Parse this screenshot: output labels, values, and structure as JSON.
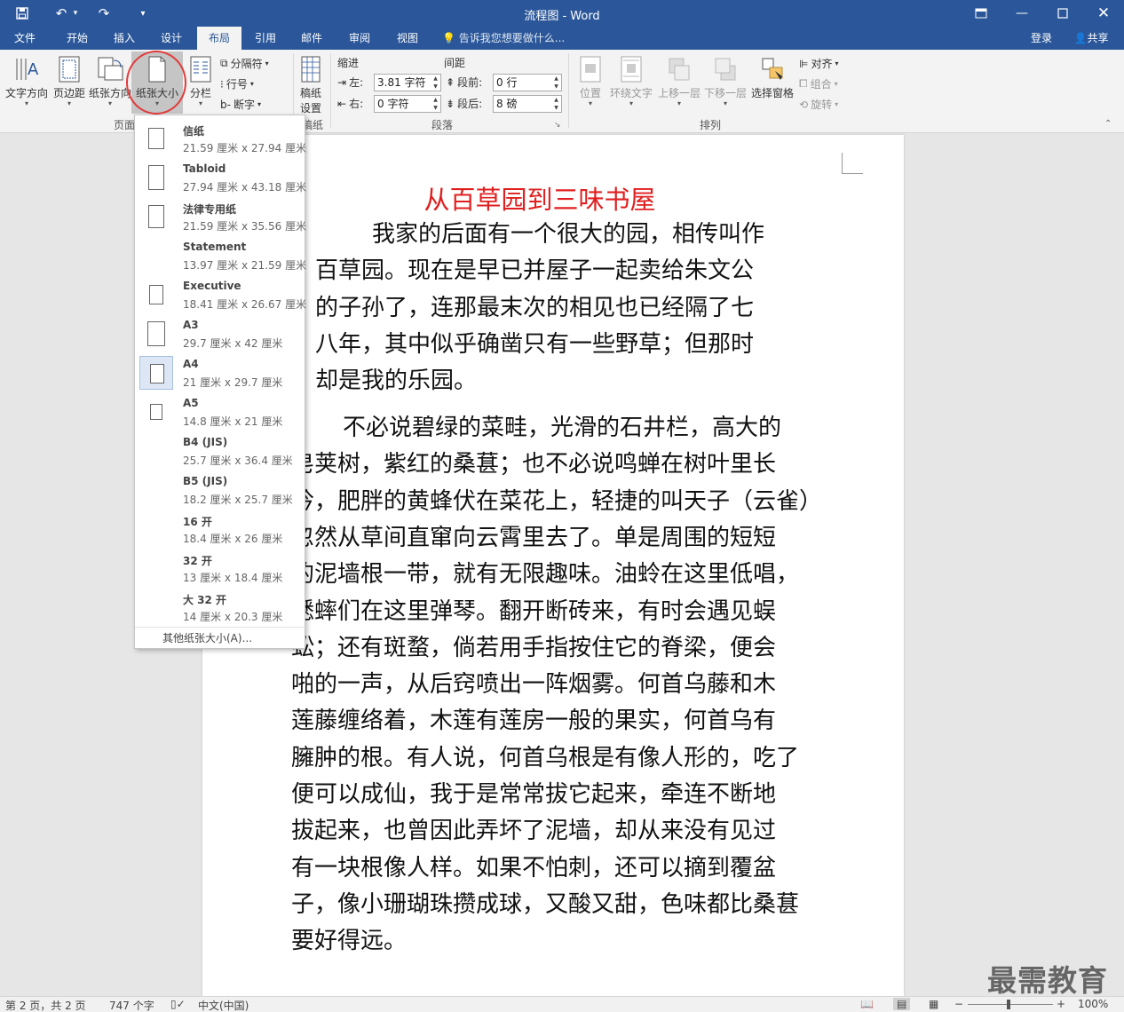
{
  "app": {
    "window_title": "流程图 - Word",
    "watermark": "最需教育"
  },
  "quick_access": [
    "save-icon",
    "undo-icon",
    "redo-icon",
    "customize-icon"
  ],
  "tabs": {
    "file": "文件",
    "home": "开始",
    "insert": "插入",
    "design": "设计",
    "layout": "布局",
    "references": "引用",
    "mailings": "邮件",
    "review": "审阅",
    "view": "视图"
  },
  "tell_me": "告诉我您想要做什么...",
  "account": {
    "login": "登录",
    "share": "共享"
  },
  "ribbon": {
    "page_setup": {
      "text_direction": "文字方向",
      "margins": "页边距",
      "orientation": "纸张方向",
      "size": "纸张大小",
      "columns": "分栏",
      "breaks": "分隔符",
      "line_numbers": "行号",
      "hyphenation": "断字",
      "group_label": "页面"
    },
    "manuscript": {
      "label": "稿纸",
      "label2": "设置",
      "group_label": "稿纸"
    },
    "paragraph": {
      "indent_title": "缩进",
      "spacing_title": "间距",
      "left_label": "左:",
      "right_label": "右:",
      "left_value": "3.81 字符",
      "right_value": "0 字符",
      "before_label": "段前:",
      "after_label": "段后:",
      "before_value": "0 行",
      "after_value": "8 磅",
      "group_label": "段落"
    },
    "arrange": {
      "position": "位置",
      "wrap_text": "环绕文字",
      "bring_forward": "上移一层",
      "send_backward": "下移一层",
      "selection_pane": "选择窗格",
      "align": "对齐",
      "group": "组合",
      "rotate": "旋转",
      "group_label": "排列"
    }
  },
  "paper_sizes": [
    {
      "name": "信纸",
      "dims": "21.59 厘米 x 27.94 厘米"
    },
    {
      "name": "Tabloid",
      "dims": "27.94 厘米 x 43.18 厘米"
    },
    {
      "name": "法律专用纸",
      "dims": "21.59 厘米 x 35.56 厘米"
    },
    {
      "name": "Statement",
      "dims": "13.97 厘米 x 21.59 厘米"
    },
    {
      "name": "Executive",
      "dims": "18.41 厘米 x 26.67 厘米"
    },
    {
      "name": "A3",
      "dims": "29.7 厘米 x 42 厘米"
    },
    {
      "name": "A4",
      "dims": "21 厘米 x 29.7 厘米"
    },
    {
      "name": "A5",
      "dims": "14.8 厘米 x 21 厘米"
    },
    {
      "name": "B4 (JIS)",
      "dims": "25.7 厘米 x 36.4 厘米"
    },
    {
      "name": "B5 (JIS)",
      "dims": "18.2 厘米 x 25.7 厘米"
    },
    {
      "name": "16 开",
      "dims": "18.4 厘米 x 26 厘米"
    },
    {
      "name": "32 开",
      "dims": "13 厘米 x 18.4 厘米"
    },
    {
      "name": "大 32 开",
      "dims": "14 厘米 x 20.3 厘米"
    }
  ],
  "paper_selected": "A4",
  "more_paper_sizes": "其他纸张大小(A)...",
  "document": {
    "heading": "从百草园到三味书屋",
    "para1_lines": [
      "我家的后面有一个很大的园，相传叫作",
      "百草园。现在是早已并屋子一起卖给朱文公",
      "的子孙了，连那最末次的相见也已经隔了七",
      "八年，其中似乎确凿只有一些野草；但那时",
      "却是我的乐园。"
    ],
    "para2_lines": [
      "不必说碧绿的菜畦，光滑的石井栏，高大的",
      "皂荚树，紫红的桑葚；也不必说鸣蝉在树叶里长",
      "吟，肥胖的黄蜂伏在菜花上，轻捷的叫天子（云雀）",
      "忽然从草间直窜向云霄里去了。单是周围的短短",
      "的泥墙根一带，就有无限趣味。油蛉在这里低唱，",
      "蟋蟀们在这里弹琴。翻开断砖来，有时会遇见蜈",
      "蚣；还有斑蝥，倘若用手指按住它的脊梁，便会",
      "啪的一声，从后窍喷出一阵烟雾。何首乌藤和木",
      "莲藤缠络着，木莲有莲房一般的果实，何首乌有",
      "臃肿的根。有人说，何首乌根是有像人形的，吃了",
      "便可以成仙，我于是常常拔它起来，牵连不断地",
      "拔起来，也曾因此弄坏了泥墙，却从来没有见过",
      "有一块根像人样。如果不怕刺，还可以摘到覆盆",
      "子，像小珊瑚珠攒成球，又酸又甜，色味都比桑葚",
      "要好得远。"
    ]
  },
  "status": {
    "page": "第 2 页，共 2 页",
    "words": "747 个字",
    "language": "中文(中国)",
    "zoom": "100%"
  },
  "colors": {
    "accent": "#2b579a",
    "heading": "#e02020",
    "circle": "#e23c3c"
  }
}
